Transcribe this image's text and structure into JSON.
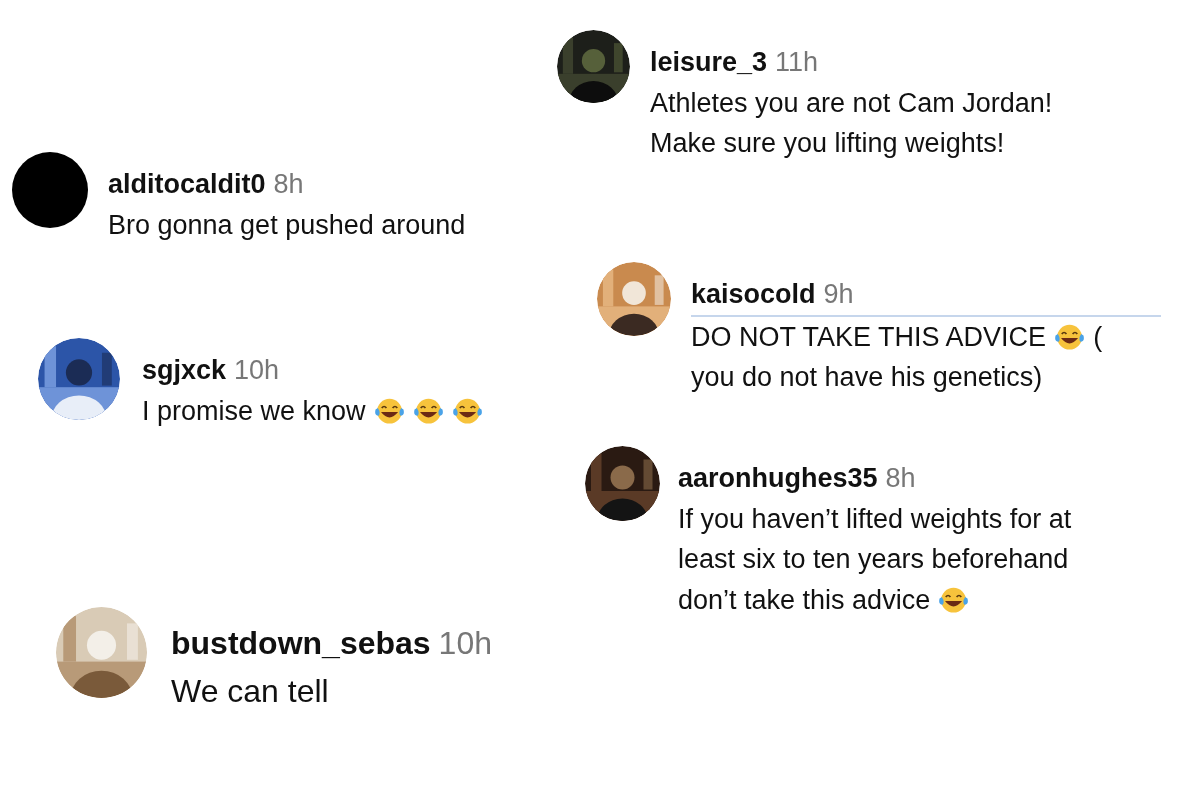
{
  "comments": [
    {
      "username": "leisure_3",
      "time": "11h",
      "avatar": {
        "kind": "picture"
      },
      "underline": false,
      "lines": [
        [
          {
            "kind": "text",
            "text": "Athletes you are not Cam Jordan!"
          }
        ],
        [
          {
            "kind": "text",
            "text": "Make sure you lifting weights!"
          }
        ]
      ]
    },
    {
      "username": "alditocaldit0",
      "time": "8h",
      "avatar": {
        "kind": "plain"
      },
      "underline": false,
      "lines": [
        [
          {
            "kind": "text",
            "text": "Bro gonna get pushed around"
          }
        ]
      ]
    },
    {
      "username": "kaisocold",
      "time": "9h",
      "avatar": {
        "kind": "picture"
      },
      "underline": true,
      "lines": [
        [
          {
            "kind": "text",
            "text": "DO NOT TAKE THIS ADVICE"
          },
          {
            "kind": "emoji"
          },
          {
            "kind": "text",
            "text": "("
          }
        ],
        [
          {
            "kind": "text",
            "text": "you do not have his genetics)"
          }
        ]
      ]
    },
    {
      "username": "sgjxck",
      "time": "10h",
      "avatar": {
        "kind": "picture"
      },
      "underline": false,
      "lines": [
        [
          {
            "kind": "text",
            "text": "I promise we know"
          },
          {
            "kind": "emoji"
          },
          {
            "kind": "emoji"
          },
          {
            "kind": "emoji"
          }
        ]
      ]
    },
    {
      "username": "aaronhughes35",
      "time": "8h",
      "avatar": {
        "kind": "picture"
      },
      "underline": false,
      "lines": [
        [
          {
            "kind": "text",
            "text": "If you haven’t lifted weights for at"
          }
        ],
        [
          {
            "kind": "text",
            "text": "least six to ten years beforehand"
          }
        ],
        [
          {
            "kind": "text",
            "text": "don’t take this advice"
          },
          {
            "kind": "emoji"
          }
        ]
      ]
    },
    {
      "username": "bustdown_sebas",
      "time": "10h",
      "avatar": {
        "kind": "picture"
      },
      "underline": false,
      "lines": [
        [
          {
            "kind": "text",
            "text": "We can tell"
          }
        ]
      ]
    }
  ]
}
